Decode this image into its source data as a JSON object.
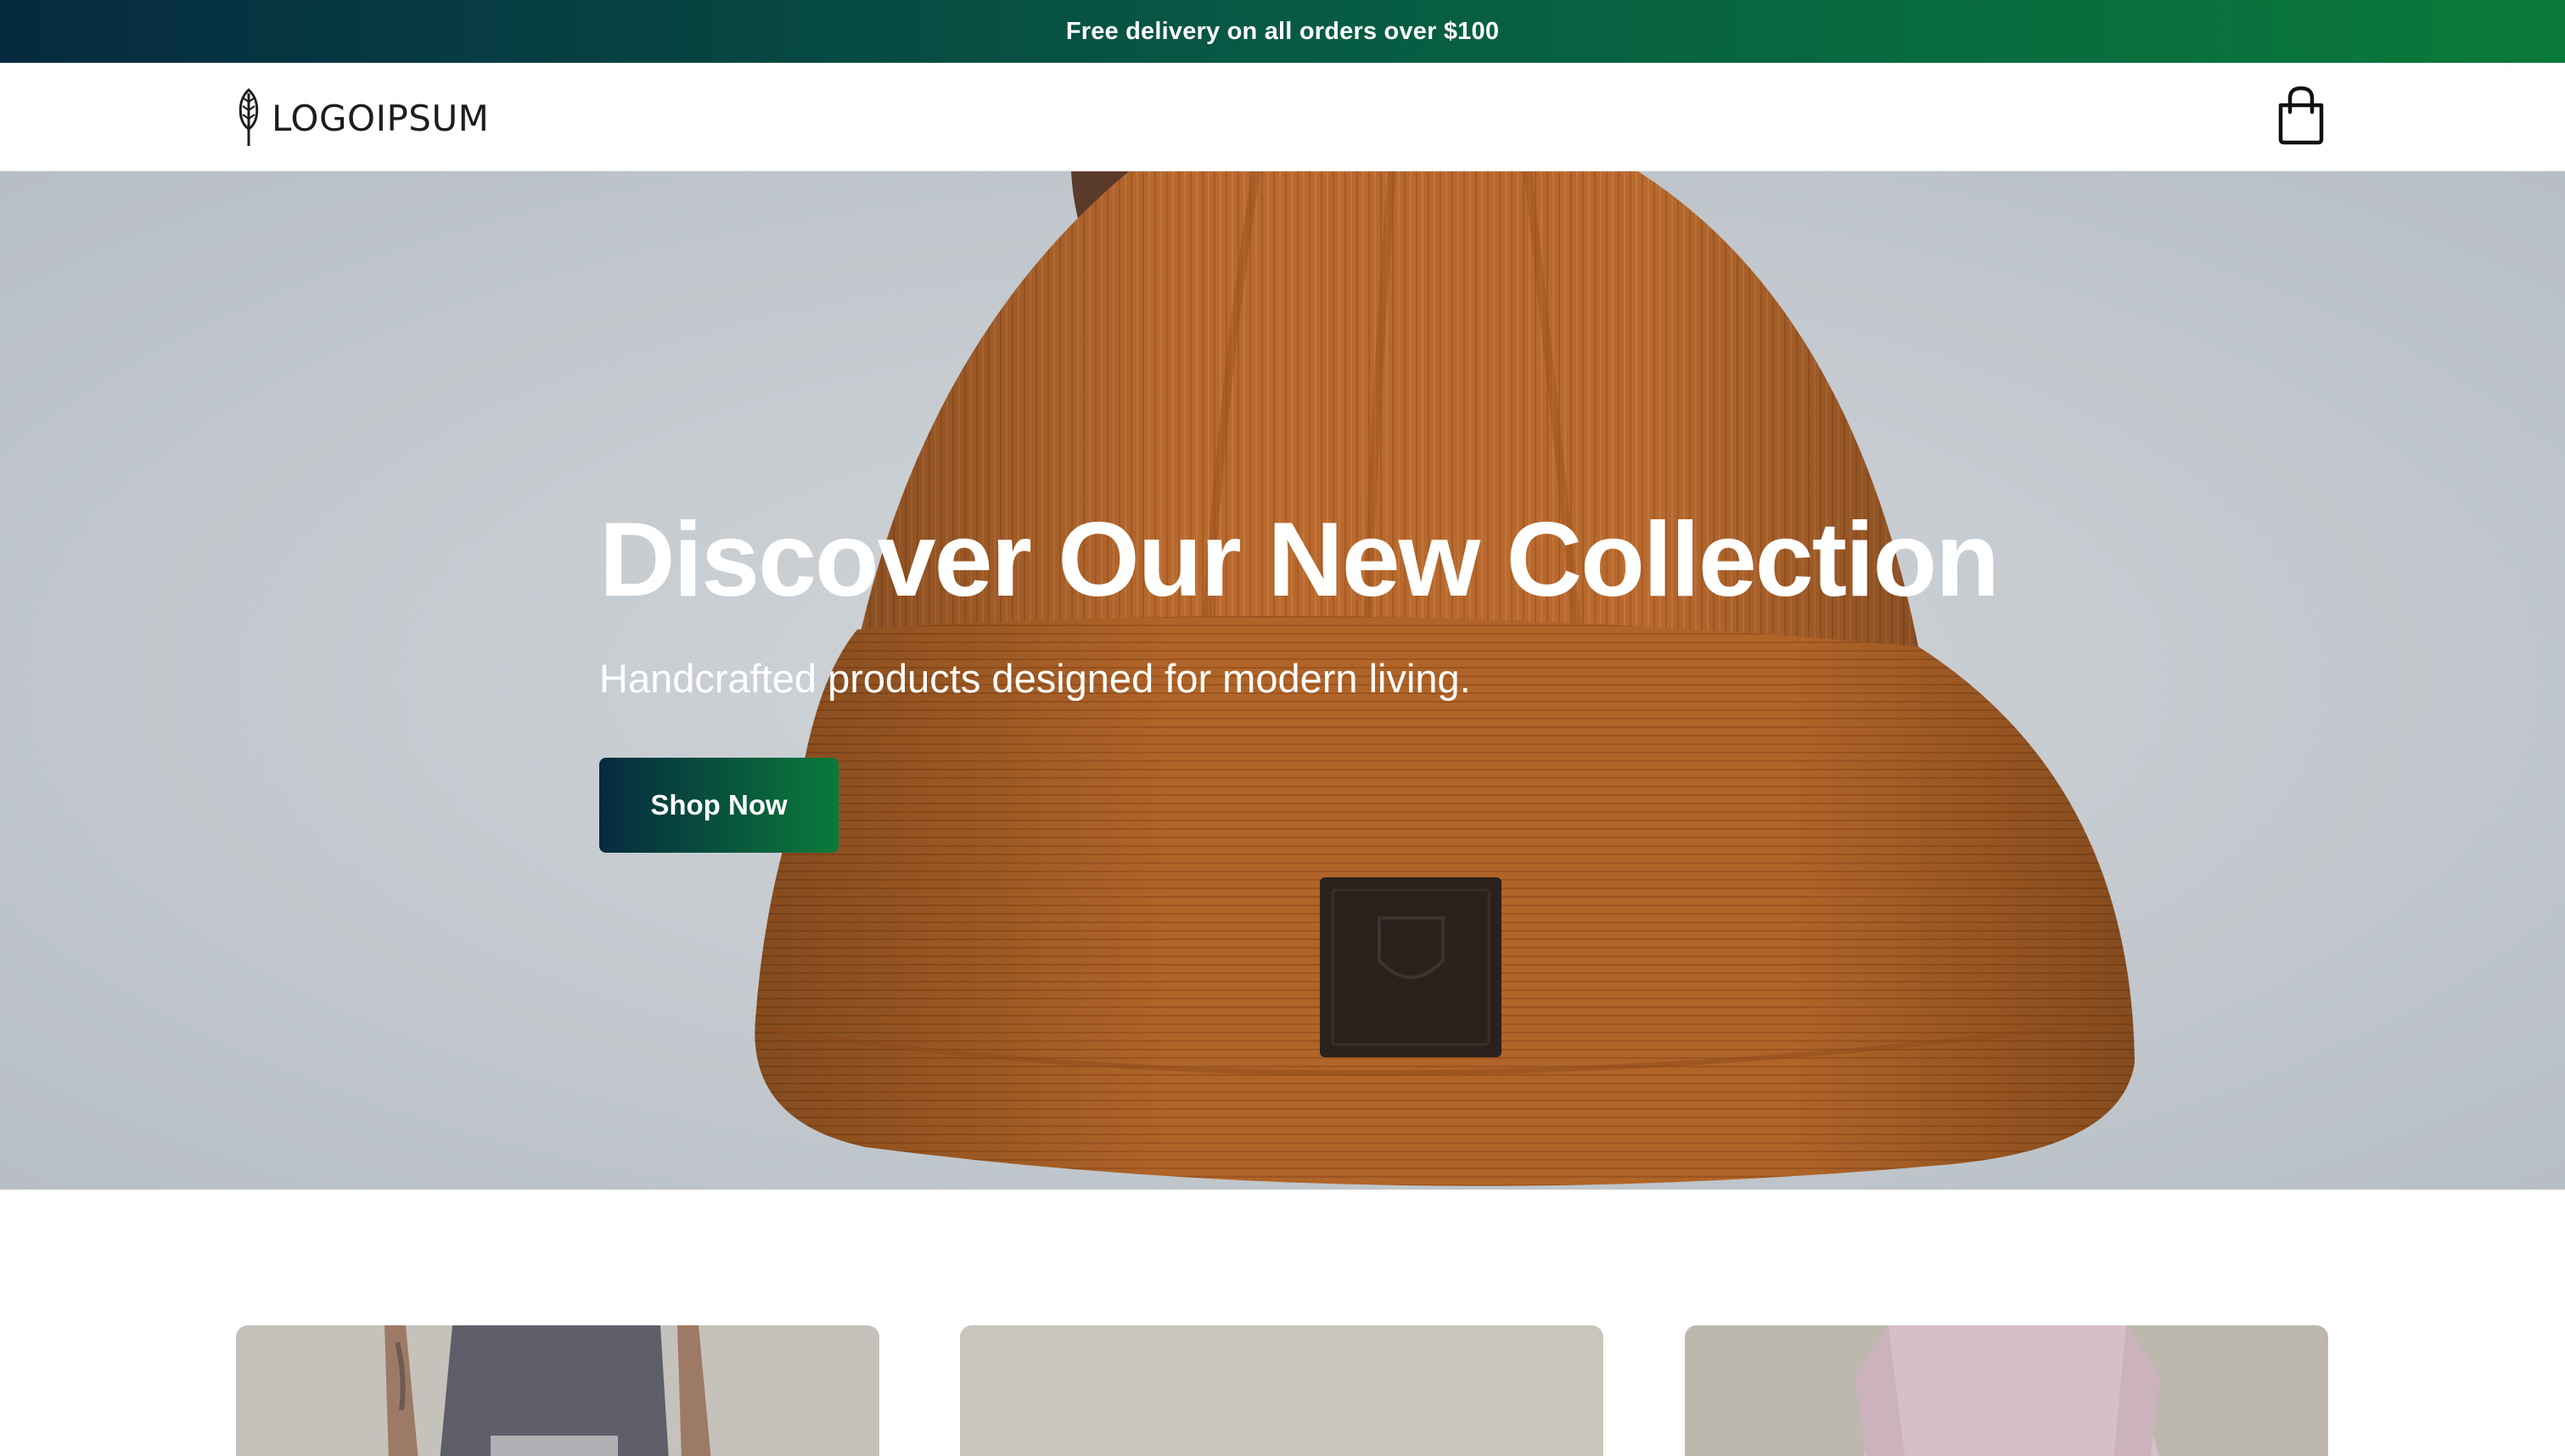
{
  "announcement": {
    "text": "Free delivery on all orders over $100"
  },
  "header": {
    "logo_text": "LOGOIPSUM",
    "logo_icon": "leaf-icon",
    "cart_icon": "shopping-bag-icon"
  },
  "hero": {
    "title": "Discover Our New Collection",
    "subtitle": "Handcrafted products designed for modern living.",
    "cta_label": "Shop Now"
  },
  "products": [
    {
      "name": "product-card-tank-top"
    },
    {
      "name": "product-card-neutral"
    },
    {
      "name": "product-card-sweatshirt"
    }
  ],
  "colors": {
    "gradient_start": "#062a40",
    "gradient_end": "#0a7a3a",
    "hero_bg": "#c4cacf",
    "beanie": "#b8692e"
  }
}
